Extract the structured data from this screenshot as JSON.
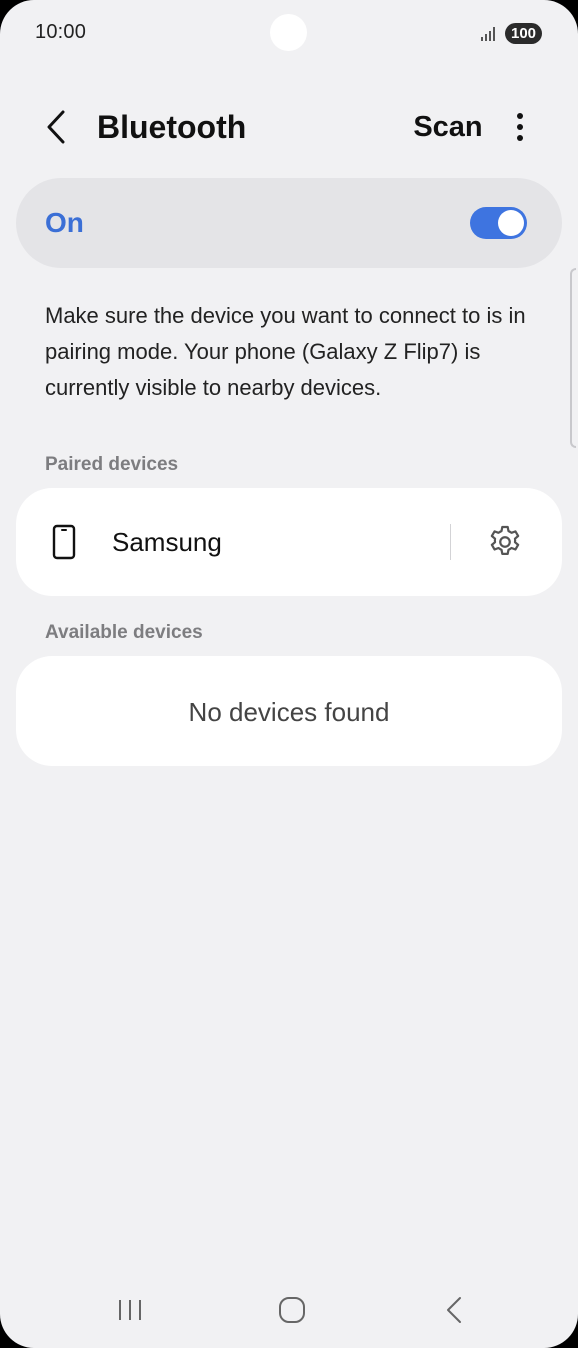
{
  "status_bar": {
    "time": "10:00",
    "battery": "100",
    "icons": {
      "signal": "signal-icon",
      "battery": "battery-icon"
    }
  },
  "header": {
    "title": "Bluetooth",
    "scan_label": "Scan",
    "icons": {
      "back": "chevron-left-icon",
      "more": "more-vertical-icon"
    }
  },
  "bluetooth_toggle": {
    "label": "On",
    "enabled": true,
    "accent_color": "#3b6fd6"
  },
  "description": "Make sure the device you want to connect to is in pairing mode. Your phone (Galaxy Z Flip7) is currently visible to nearby devices.",
  "paired_devices": {
    "header": "Paired devices",
    "items": [
      {
        "name": "Samsung",
        "icon": "phone-icon",
        "settings_icon": "gear-icon"
      }
    ]
  },
  "available_devices": {
    "header": "Available devices",
    "empty_message": "No devices found"
  },
  "nav_bar": {
    "icons": {
      "recents": "recents-icon",
      "home": "home-icon",
      "back": "back-icon"
    }
  }
}
